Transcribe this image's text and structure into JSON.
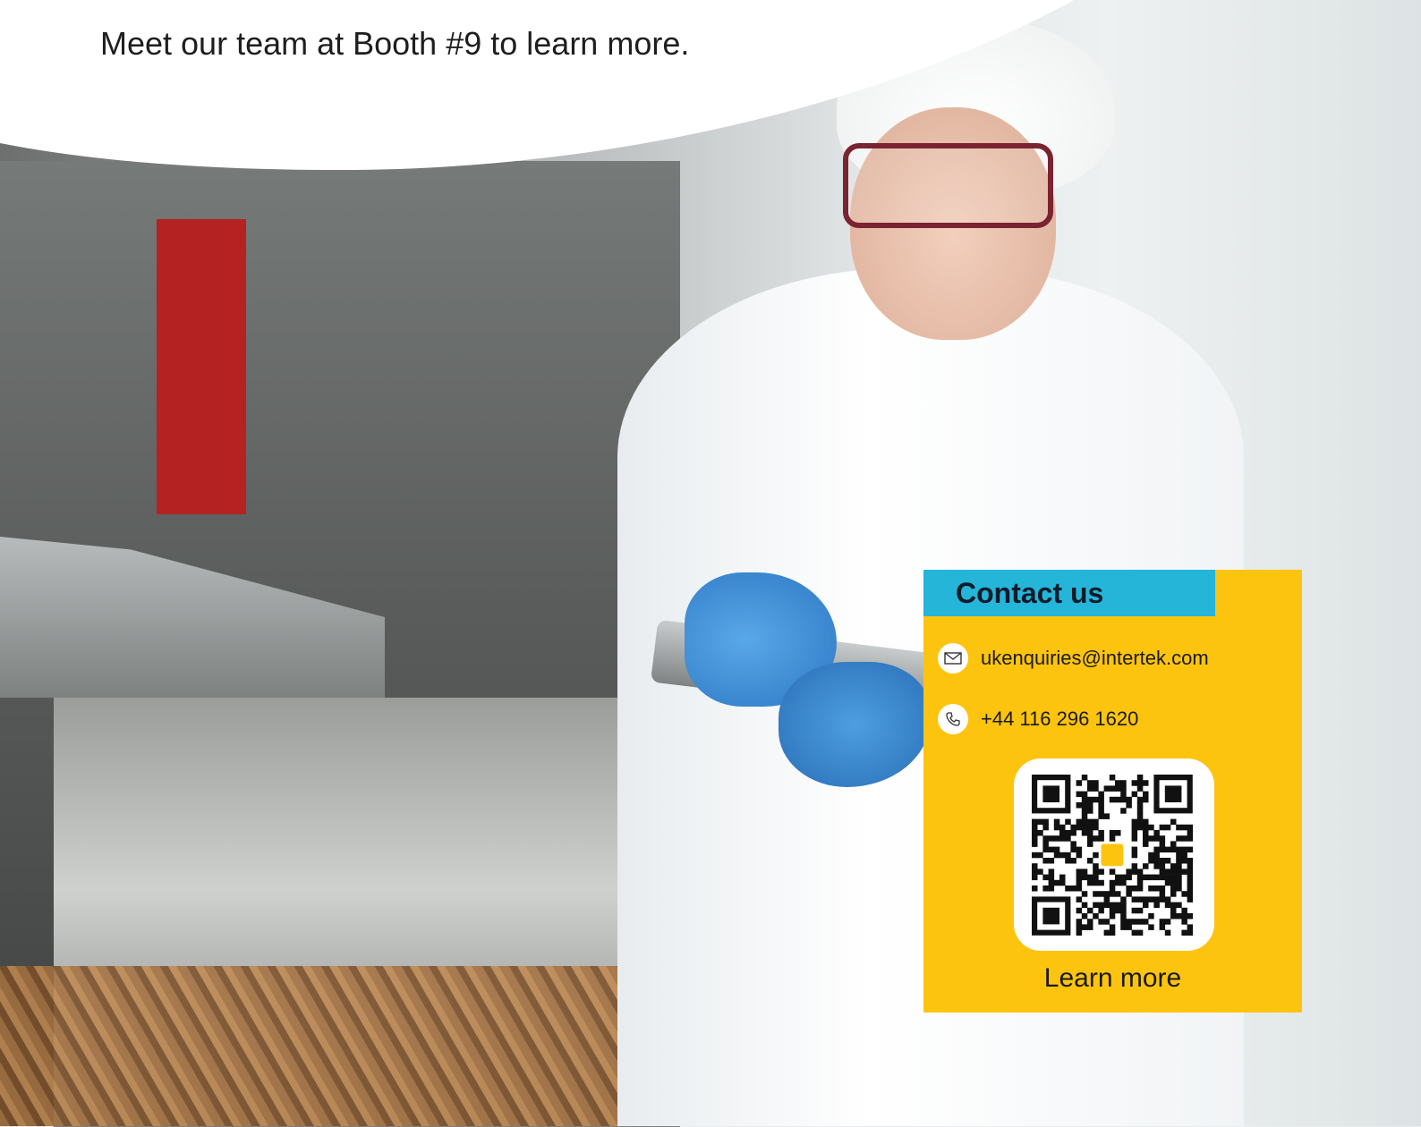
{
  "headline": "Meet our team at Booth #9 to learn more.",
  "contact": {
    "title": "Contact us",
    "email": "ukenquiries@intertek.com",
    "phone": "+44 116 296 1620",
    "learn_more": "Learn more"
  },
  "colors": {
    "card_background": "#fdc40f",
    "title_tab": "#25b5d9",
    "glove_blue": "#3e8fd9"
  },
  "icons": {
    "email": "envelope-icon",
    "phone": "phone-icon",
    "qr": "qr-code"
  }
}
